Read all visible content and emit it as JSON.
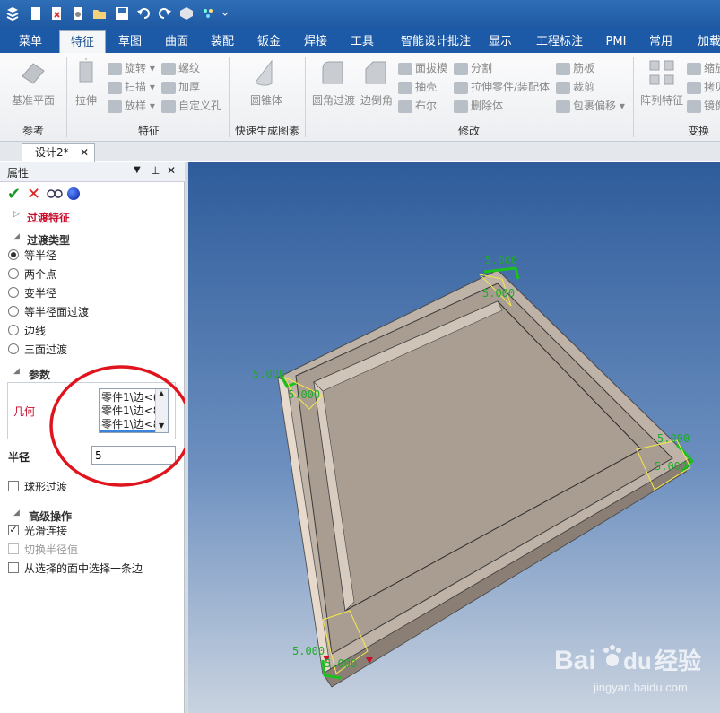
{
  "ribbon_tabs": [
    "菜单",
    "特征",
    "草图",
    "曲面",
    "装配",
    "钣金",
    "焊接",
    "工具",
    "智能设计批注",
    "显示",
    "工程标注",
    "PMI",
    "常用",
    "加载"
  ],
  "active_tab": "特征",
  "ribbon": {
    "groups": {
      "reference": "参考",
      "feature": "特征",
      "quick": "快速生成图素",
      "modify": "修改",
      "transform": "变换"
    },
    "reference": {
      "datum_plane": "基准平面"
    },
    "feature": {
      "extrude": "拉伸",
      "revolve": "旋转",
      "sweep": "扫描",
      "loft": "放样",
      "thread": "螺纹",
      "thicken": "加厚",
      "custom_hole": "自定义孔"
    },
    "quick": {
      "cone": "圆锥体"
    },
    "modify": {
      "fillet": "圆角过渡",
      "chamfer": "边倒角",
      "draft": "面拔模",
      "shell": "抽壳",
      "boolean": "布尔",
      "split": "分割",
      "extrude_part": "拉伸零件/装配体",
      "delete_body": "删除体",
      "rib": "筋板",
      "trim": "裁剪",
      "wrap_offset": "包裹偏移"
    },
    "transform": {
      "pattern": "阵列特征",
      "scale": "缩放",
      "copy": "拷贝",
      "mirror": "镜像"
    }
  },
  "document_tab": "设计2*",
  "panel": {
    "title": "属性",
    "feature_name": "过渡特征",
    "type_section": "过渡类型",
    "types": [
      "等半径",
      "两个点",
      "变半径",
      "等半径面过渡",
      "边线",
      "三面过渡"
    ],
    "selected_type": "等半径",
    "params_section": "参数",
    "geometry_label": "几何",
    "geometry_items": [
      "零件1\\边<(",
      "零件1\\边<8",
      "零件1\\边<8"
    ],
    "radius_label": "半径",
    "radius_value": "5",
    "sphere_transition": "球形过渡",
    "advanced_section": "高级操作",
    "smooth_connect": "光滑连接",
    "switch_radius": "切换半径值",
    "select_edge_from_face": "从选择的面中选择一条边"
  },
  "viewport": {
    "dimension_labels": [
      "5.000",
      "5.000",
      "5.000",
      "5.000",
      "5.000",
      "5.000",
      "5.000",
      "5.000"
    ],
    "watermark_brand": "Bai",
    "watermark_cn": "经验",
    "watermark_url": "jingyan.baidu.com"
  },
  "colors": {
    "titlebar": "#1f5aa3",
    "viewport_top": "#2e5c9b",
    "part_face": "#a89c91",
    "dimension": "#1faa2a",
    "annotation_circle": "#e0141c",
    "feature_red": "#c8102e"
  }
}
